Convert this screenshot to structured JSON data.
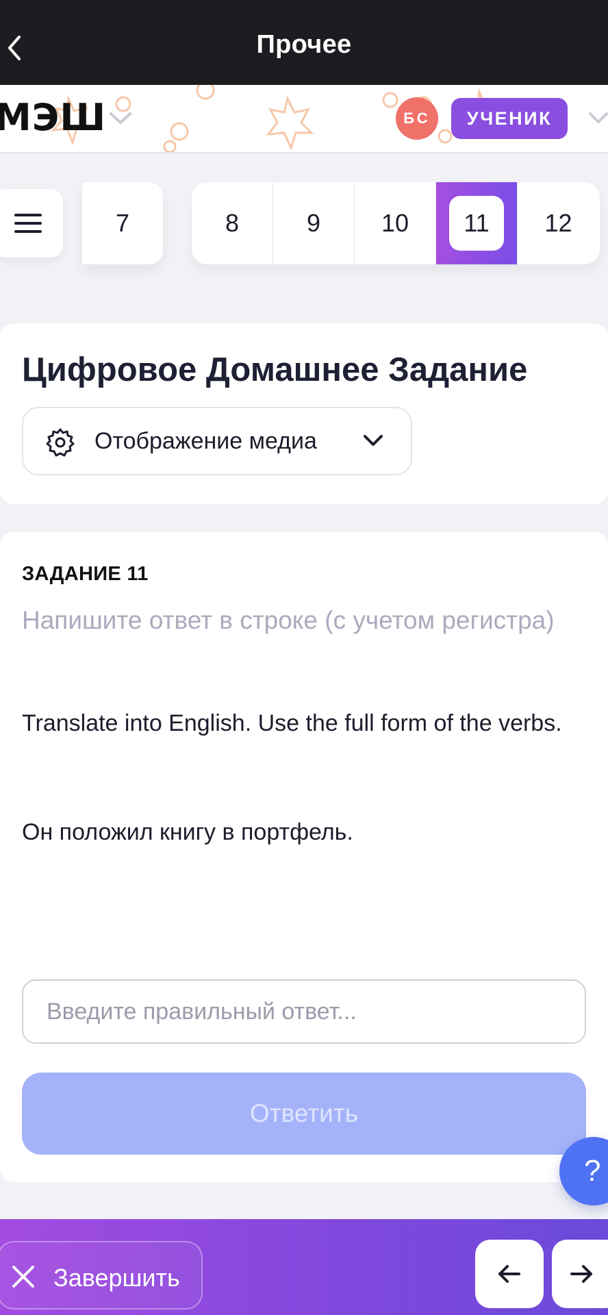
{
  "topbar": {
    "title": "Прочее",
    "back_icon": "chevron-left-icon"
  },
  "header": {
    "logo": "МЭШ",
    "avatar_initials": "БС",
    "role": "УЧЕНИК",
    "colors": {
      "avatar": "#f0706a",
      "role": "#8a4fe0"
    }
  },
  "task_nav": {
    "items": [
      "7",
      "8",
      "9",
      "10",
      "11",
      "12"
    ],
    "active": "11",
    "menu_icon": "hamburger-icon"
  },
  "title_card": {
    "title": "Цифровое Домашнее Задание",
    "media_button": "Отображение медиа"
  },
  "task": {
    "label": "ЗАДАНИЕ 11",
    "hint": "Напишите ответ в строке (с учетом регистра)",
    "instruction": "Translate into English. Use the full form of the verbs.",
    "sentence": "Он положил книгу в портфель.",
    "input_placeholder": "Введите правильный ответ...",
    "submit_label": "Ответить"
  },
  "help": {
    "label": "?"
  },
  "bottombar": {
    "finish_label": "Завершить"
  }
}
